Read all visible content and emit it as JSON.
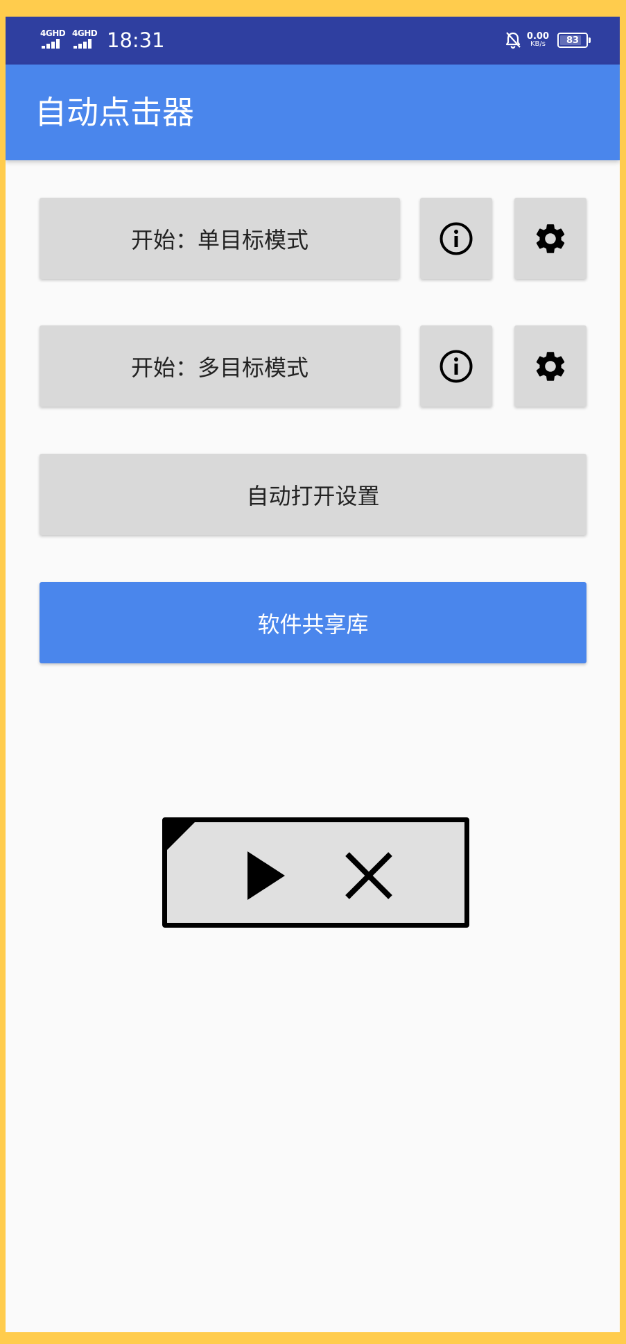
{
  "status_bar": {
    "network_1": "4GHD",
    "network_2": "4GHD",
    "time": "18:31",
    "speed_value": "0.00",
    "speed_unit": "KB/s",
    "battery_level": "83",
    "battery_fraction": 0.83,
    "icons": [
      "signal-icon",
      "bell-off-icon",
      "battery-icon"
    ]
  },
  "app_bar": {
    "title": "自动点击器"
  },
  "rows": [
    {
      "start_label": "开始：单目标模式",
      "icons": [
        "info-icon",
        "gear-icon"
      ]
    },
    {
      "start_label": "开始：多目标模式",
      "icons": [
        "info-icon",
        "gear-icon"
      ]
    }
  ],
  "auto_settings_label": "自动打开设置",
  "share_library_label": "软件共享库",
  "floating_panel": {
    "icons": [
      "play-icon",
      "close-icon"
    ]
  },
  "colors": {
    "frame": "#FFCC4D",
    "status_bar": "#2F3FA0",
    "accent": "#4A86EC",
    "button": "#D9D9D9",
    "background": "#FAFAFA"
  }
}
